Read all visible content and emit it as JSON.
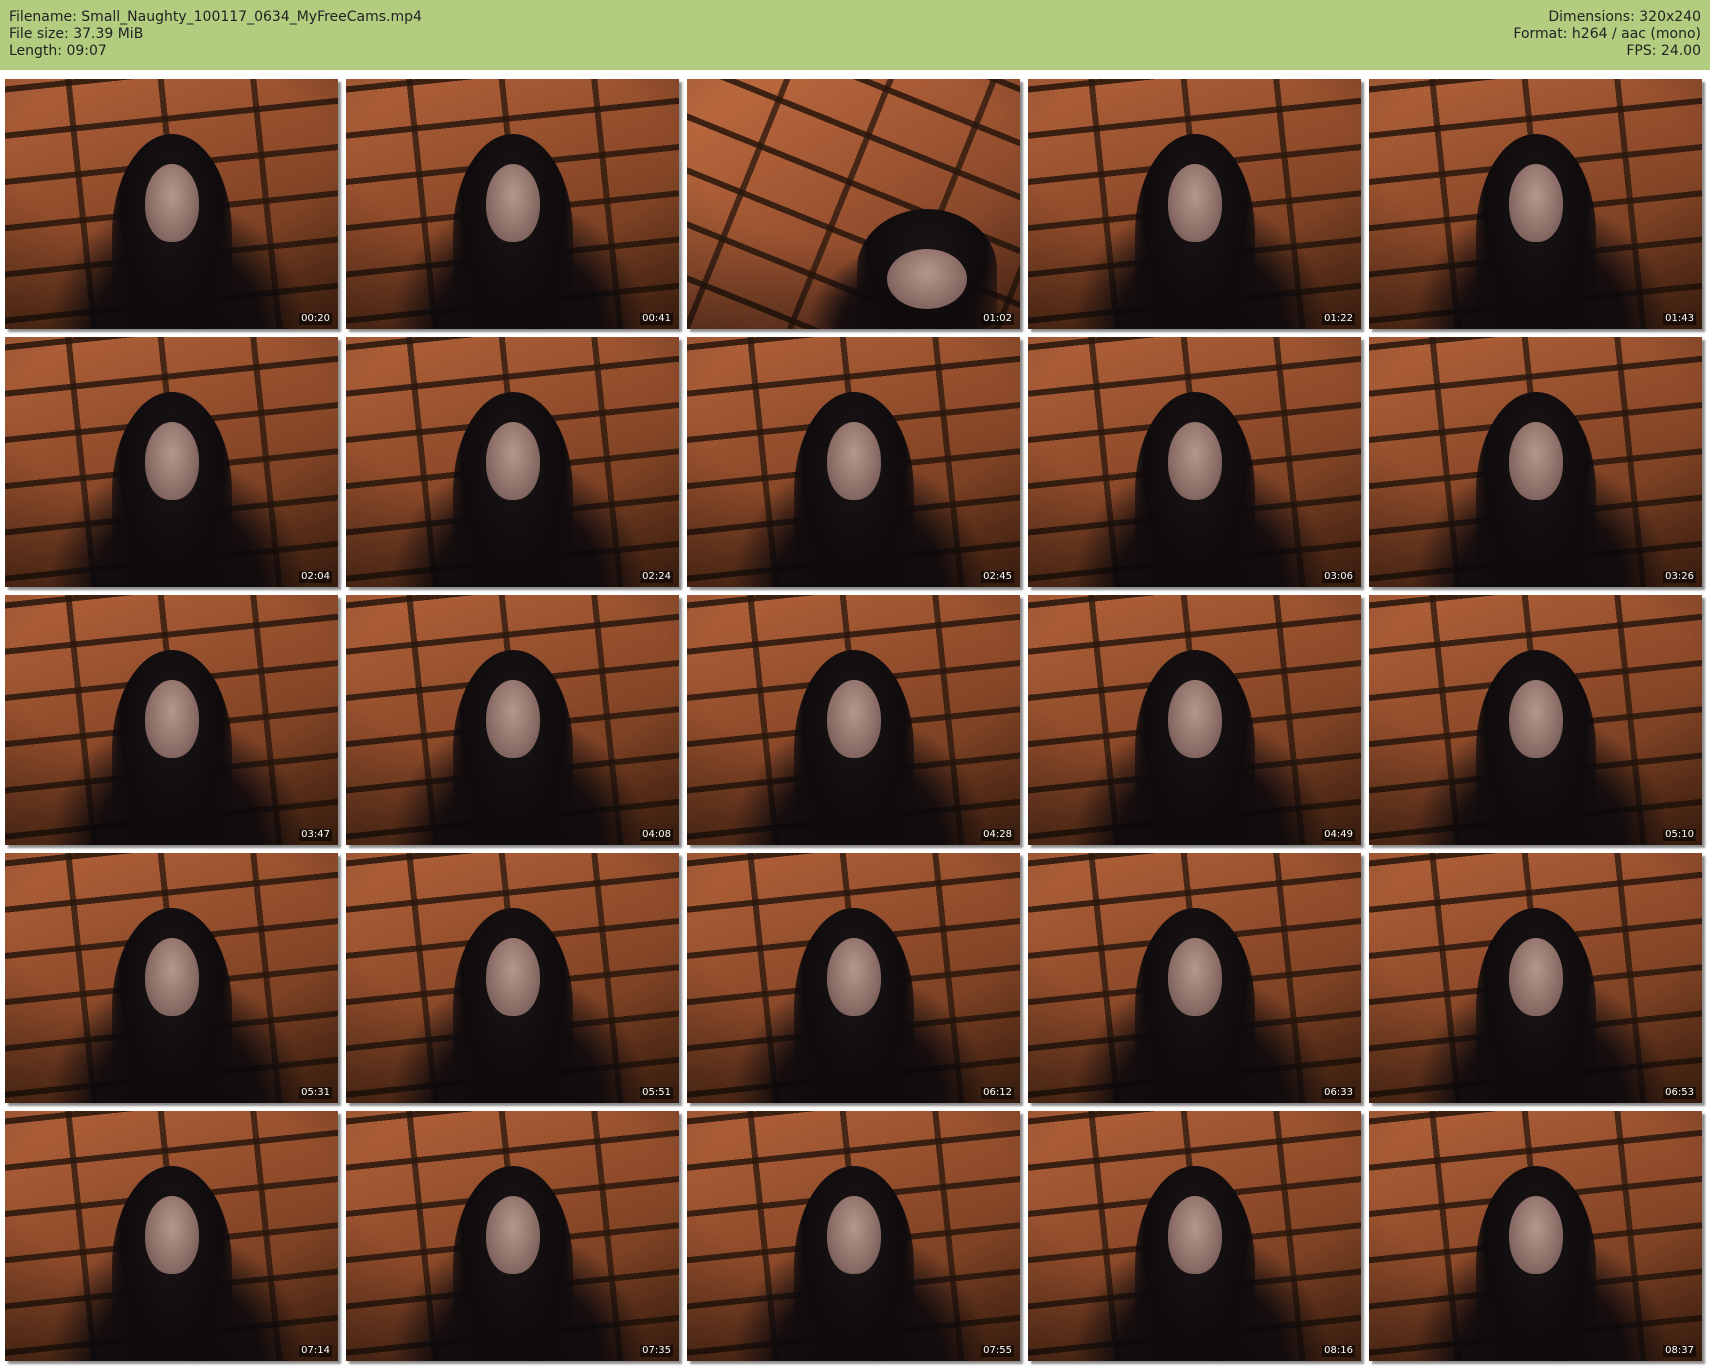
{
  "colors": {
    "header_background": "#b3cd80",
    "page_background": "#ffffff",
    "header_text": "#222222"
  },
  "header": {
    "filename": "Filename: Small_Naughty_100117_0634_MyFreeCams.mp4",
    "file_size": "File size: 37.39 MiB",
    "length": "Length: 09:07",
    "dimensions": "Dimensions: 320x240",
    "format": "Format: h264 / aac (mono)",
    "fps": "FPS: 24.00"
  },
  "thumbnails": [
    {
      "timestamp": "00:20"
    },
    {
      "timestamp": "00:41"
    },
    {
      "timestamp": "01:02"
    },
    {
      "timestamp": "01:22"
    },
    {
      "timestamp": "01:43"
    },
    {
      "timestamp": "02:04"
    },
    {
      "timestamp": "02:24"
    },
    {
      "timestamp": "02:45"
    },
    {
      "timestamp": "03:06"
    },
    {
      "timestamp": "03:26"
    },
    {
      "timestamp": "03:47"
    },
    {
      "timestamp": "04:08"
    },
    {
      "timestamp": "04:28"
    },
    {
      "timestamp": "04:49"
    },
    {
      "timestamp": "05:10"
    },
    {
      "timestamp": "05:31"
    },
    {
      "timestamp": "05:51"
    },
    {
      "timestamp": "06:12"
    },
    {
      "timestamp": "06:33"
    },
    {
      "timestamp": "06:53"
    },
    {
      "timestamp": "07:14"
    },
    {
      "timestamp": "07:35"
    },
    {
      "timestamp": "07:55"
    },
    {
      "timestamp": "08:16"
    },
    {
      "timestamp": "08:37"
    }
  ]
}
